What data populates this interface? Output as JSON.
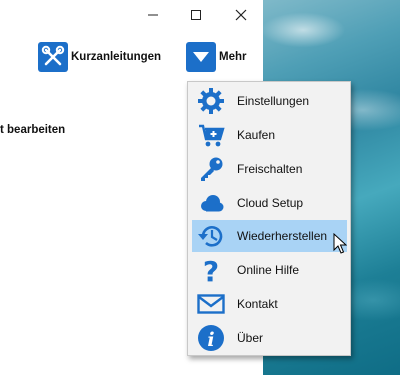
{
  "toolbar": {
    "quick_guides_label": "Kurzanleitungen",
    "more_label": "Mehr"
  },
  "content": {
    "edit_text": "t bearbeiten"
  },
  "menu": {
    "items": [
      {
        "label": "Einstellungen",
        "icon": "gear-icon"
      },
      {
        "label": "Kaufen",
        "icon": "cart-icon"
      },
      {
        "label": "Freischalten",
        "icon": "key-icon"
      },
      {
        "label": "Cloud Setup",
        "icon": "cloud-icon"
      },
      {
        "label": "Wiederherstellen",
        "icon": "restore-icon"
      },
      {
        "label": "Online Hilfe",
        "icon": "question-icon"
      },
      {
        "label": "Kontakt",
        "icon": "mail-icon"
      },
      {
        "label": "Über",
        "icon": "info-icon"
      }
    ],
    "hovered_index": 4
  },
  "colors": {
    "accent": "#1c6fc9",
    "menu_hover": "#a9d3f5"
  }
}
